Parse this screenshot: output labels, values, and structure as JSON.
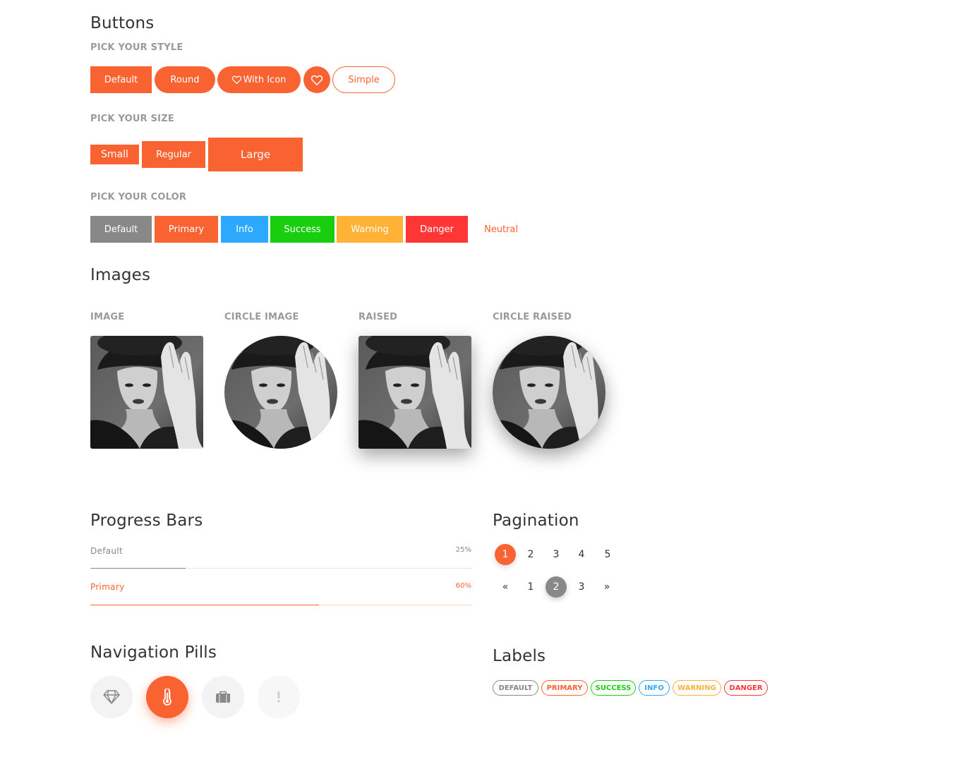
{
  "colors": {
    "primary": "#f96332",
    "default": "#888888",
    "info": "#2ca8ff",
    "success": "#18ce0f",
    "warning": "#ffb236",
    "danger": "#ff3636"
  },
  "buttons": {
    "title": "Buttons",
    "style_subtitle": "Pick your style",
    "style": {
      "default": "Default",
      "round": "Round",
      "with_icon": "With Icon",
      "with_icon_icon": "heart-icon",
      "icon_only_icon": "heart-icon",
      "simple": "Simple"
    },
    "size_subtitle": "Pick your size",
    "size": {
      "small": "Small",
      "regular": "Regular",
      "large": "Large"
    },
    "color_subtitle": "Pick your color",
    "color": {
      "default": "Default",
      "primary": "Primary",
      "info": "Info",
      "success": "Success",
      "warning": "Warning",
      "danger": "Danger",
      "neutral": "Neutral"
    }
  },
  "images": {
    "title": "Images",
    "items": [
      {
        "label": "Image"
      },
      {
        "label": "Circle Image"
      },
      {
        "label": "Raised"
      },
      {
        "label": "Circle Raised"
      }
    ]
  },
  "progress": {
    "title": "Progress Bars",
    "bars": [
      {
        "label": "Default",
        "value": "25%",
        "fraction": 0.25,
        "color": "#888888",
        "label_color": "#888888"
      },
      {
        "label": "Primary",
        "value": "60%",
        "fraction": 0.6,
        "color": "#f96332",
        "label_color": "#f96332"
      }
    ]
  },
  "pagination": {
    "title": "Pagination",
    "row1": [
      "1",
      "2",
      "3",
      "4",
      "5"
    ],
    "row1_active": "1",
    "row2": [
      "«",
      "1",
      "2",
      "3",
      "»"
    ],
    "row2_active": "2"
  },
  "pills": {
    "title": "Navigation Pills",
    "items": [
      {
        "icon": "diamond-icon",
        "state": "default"
      },
      {
        "icon": "thermometer-icon",
        "state": "active"
      },
      {
        "icon": "briefcase-icon",
        "state": "default"
      },
      {
        "icon": "exclamation-icon",
        "state": "disabled"
      }
    ]
  },
  "labels": {
    "title": "Labels",
    "items": [
      {
        "text": "Default",
        "color": "#888888"
      },
      {
        "text": "Primary",
        "color": "#f96332"
      },
      {
        "text": "Success",
        "color": "#18ce0f"
      },
      {
        "text": "Info",
        "color": "#2ca8ff"
      },
      {
        "text": "Warning",
        "color": "#ffb236"
      },
      {
        "text": "Danger",
        "color": "#ff3636"
      }
    ]
  }
}
